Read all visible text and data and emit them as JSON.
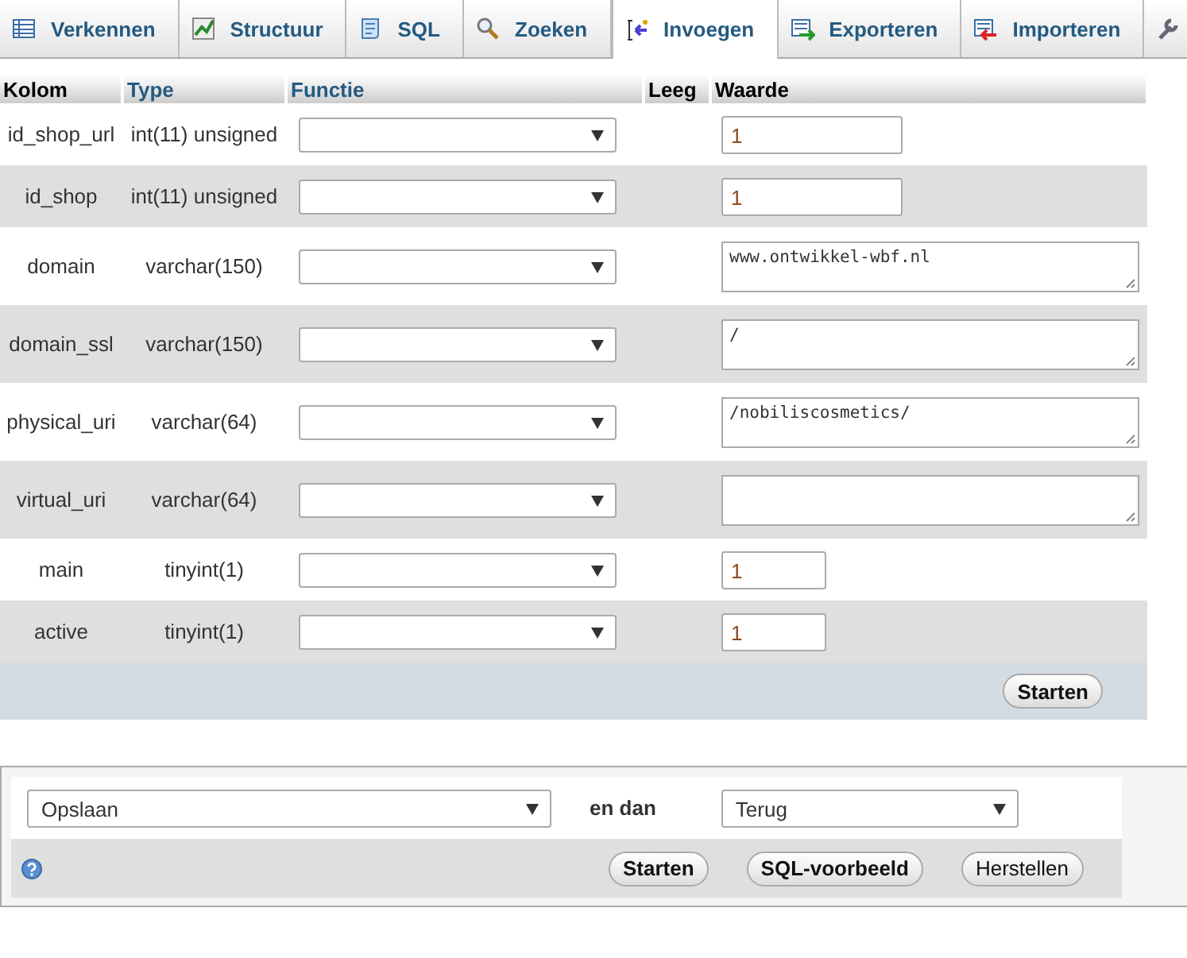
{
  "tabs": [
    {
      "label": "Verkennen",
      "selected": false
    },
    {
      "label": "Structuur",
      "selected": false
    },
    {
      "label": "SQL",
      "selected": false
    },
    {
      "label": "Zoeken",
      "selected": false
    },
    {
      "label": "Invoegen",
      "selected": true
    },
    {
      "label": "Exporteren",
      "selected": false
    },
    {
      "label": "Importeren",
      "selected": false
    },
    {
      "selected": false
    }
  ],
  "table": {
    "columns": [
      "Kolom",
      "Type",
      "Functie",
      "Leeg",
      "Waarde"
    ],
    "rows": [
      {
        "column": "id_shop_url",
        "type": "int(11) unsigned",
        "kind": "input",
        "value": "1"
      },
      {
        "column": "id_shop",
        "type": "int(11) unsigned",
        "kind": "input",
        "value": "1"
      },
      {
        "column": "domain",
        "type": "varchar(150)",
        "kind": "textarea",
        "value": "www.ontwikkel-wbf.nl"
      },
      {
        "column": "domain_ssl",
        "type": "varchar(150)",
        "kind": "textarea",
        "value": "/"
      },
      {
        "column": "physical_uri",
        "type": "varchar(64)",
        "kind": "textarea",
        "value": "/nobiliscosmetics/"
      },
      {
        "column": "virtual_uri",
        "type": "varchar(64)",
        "kind": "textarea"
      },
      {
        "column": "main",
        "type": "tinyint(1)",
        "kind": "short",
        "value": "1"
      },
      {
        "column": "active",
        "type": "tinyint(1)",
        "kind": "short",
        "value": "1"
      }
    ],
    "submit": "Starten"
  },
  "actions": {
    "action": "Opslaan",
    "then_label": "en dan",
    "after": "Terug",
    "buttons": [
      {
        "label": "Starten",
        "bold": true
      },
      {
        "label": "SQL-voorbeeld",
        "bold": true
      },
      {
        "label": "Herstellen",
        "bold": false
      }
    ]
  }
}
